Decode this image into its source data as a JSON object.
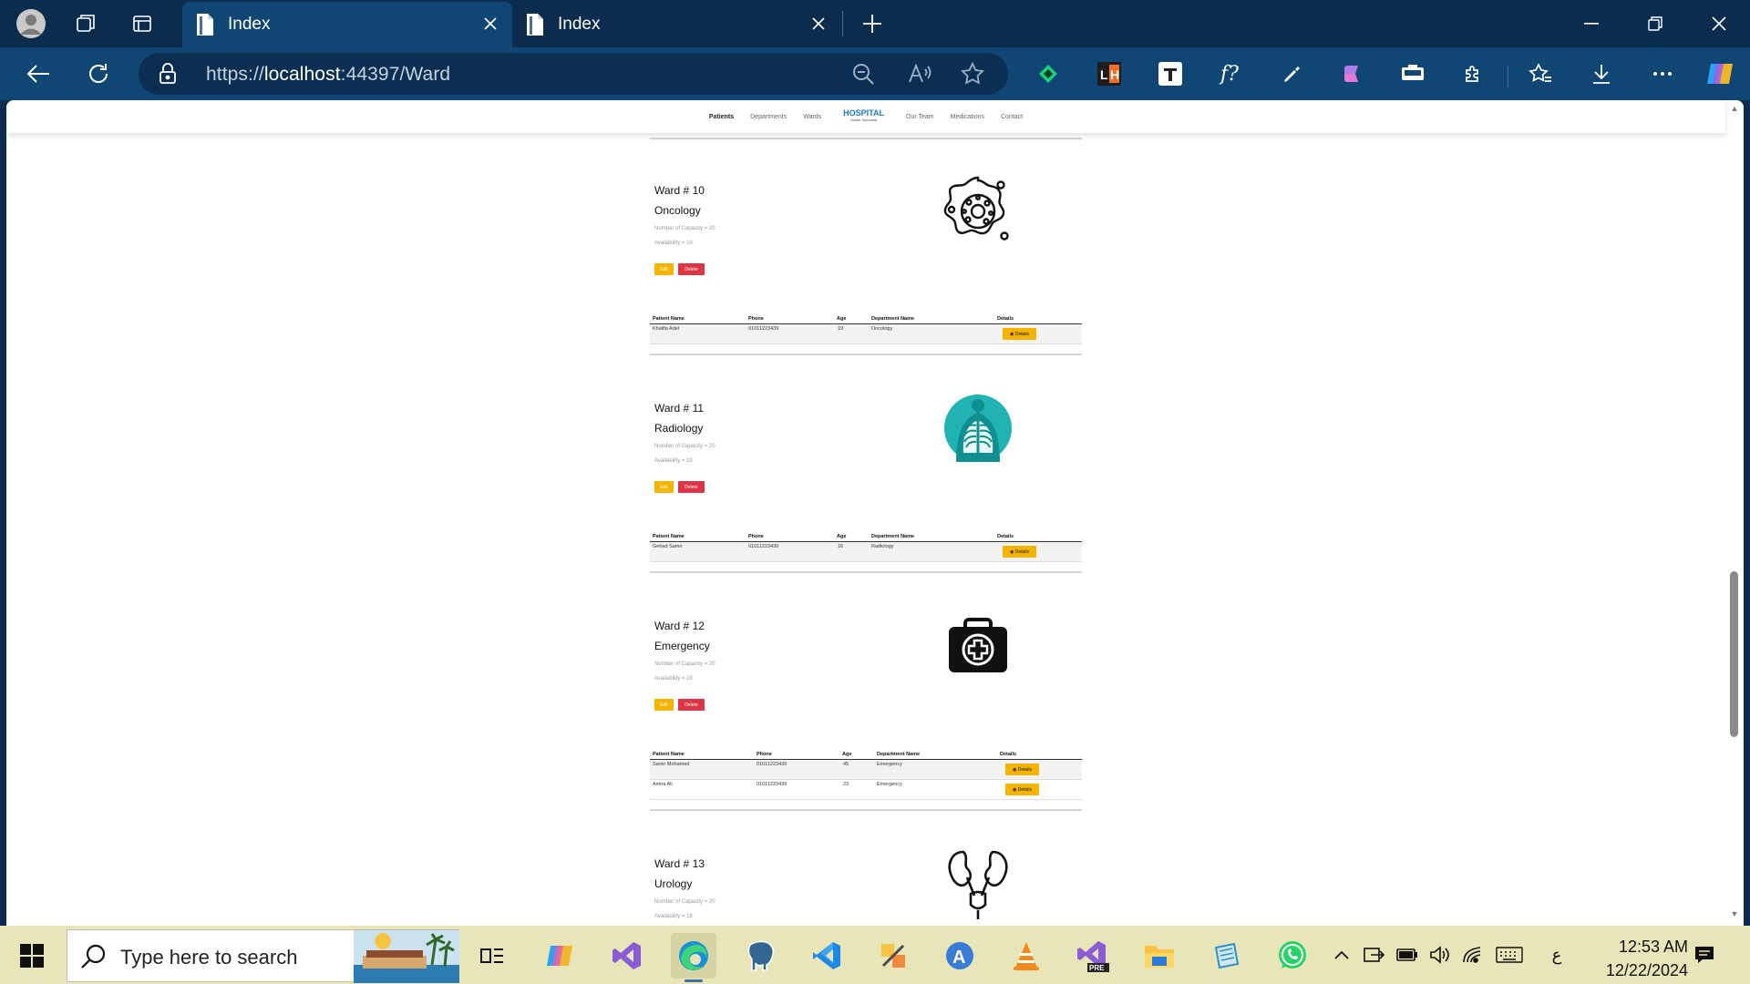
{
  "browser": {
    "tabs": [
      {
        "title": "Index",
        "active": true
      },
      {
        "title": "Index",
        "active": false
      }
    ],
    "url": {
      "scheme": "https://",
      "host": "localhost",
      "rest": ":44397/Ward"
    }
  },
  "site_nav": {
    "items_left": [
      "Patients",
      "Departments",
      "Wards"
    ],
    "brand": "HOSPITAL",
    "brand_sub": "Health Specialist",
    "items_right": [
      "Our Team",
      "Medications",
      "Contact"
    ]
  },
  "table_headers": {
    "patient_name": "Patient Name",
    "phone": "Phone",
    "age": "Age",
    "department_name": "Department Name",
    "details": "Details"
  },
  "buttons": {
    "edit": "Edit",
    "delete": "Delete",
    "details": "Details"
  },
  "wards": [
    {
      "number": "Ward # 10",
      "name": "Oncology",
      "capacity": "Number of Capacity = 20",
      "availability": "Availability = 19",
      "icon": "cancer-cell-icon",
      "patients": [
        {
          "name": "Khalifa Adel",
          "phone": "01011223439",
          "age": "19",
          "department": "Oncology"
        }
      ]
    },
    {
      "number": "Ward # 11",
      "name": "Radiology",
      "capacity": "Number of Capacity = 20",
      "availability": "Availability = 19",
      "icon": "xray-chest-icon",
      "patients": [
        {
          "name": "Gehad Samir",
          "phone": "01011223439",
          "age": "16",
          "department": "Radiology"
        }
      ]
    },
    {
      "number": "Ward # 12",
      "name": "Emergency",
      "capacity": "Number of Capacity = 20",
      "availability": "Availability = 18",
      "icon": "first-aid-kit-icon",
      "patients": [
        {
          "name": "Samir Mohamed",
          "phone": "01011223439",
          "age": "45",
          "department": "Emergency"
        },
        {
          "name": "Amira Ali",
          "phone": "01011223439",
          "age": "23",
          "department": "Emergency"
        }
      ]
    },
    {
      "number": "Ward # 13",
      "name": "Urology",
      "capacity": "Number of Capacity = 20",
      "availability": "Availability = 18",
      "icon": "kidney-urinary-icon",
      "patients": []
    }
  ],
  "taskbar": {
    "search_placeholder": "Type here to search",
    "time": "12:53 AM",
    "date": "12/22/2024",
    "language": "ع"
  },
  "colors": {
    "edit": "#f5b400",
    "delete": "#dc3545",
    "brand": "#1b79c9",
    "titlebar": "#0c2c4e",
    "toolbar": "#104673",
    "taskbar": "#e8e6b8"
  }
}
